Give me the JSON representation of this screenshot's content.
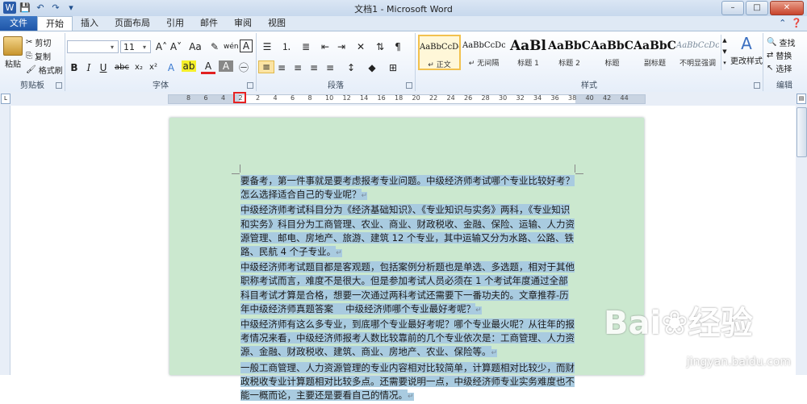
{
  "window": {
    "title": "文档1 - Microsoft Word",
    "minimize": "–",
    "maximize": "□",
    "close": "✕"
  },
  "qat": {
    "save_icon": "save-icon",
    "undo_icon": "undo-icon",
    "redo_icon": "redo-icon"
  },
  "tabs": [
    "文件",
    "开始",
    "插入",
    "页面布局",
    "引用",
    "邮件",
    "审阅",
    "视图"
  ],
  "ribbon": {
    "clipboard": {
      "label": "剪贴板",
      "paste": "粘贴",
      "cut": "剪切",
      "copy": "复制",
      "format_painter": "格式刷"
    },
    "font": {
      "label": "字体",
      "font_name": "",
      "font_size": "11",
      "bold": "B",
      "italic": "I",
      "underline": "U",
      "strike": "abc",
      "subscript": "x₂",
      "superscript": "x²",
      "grow": "A˄",
      "shrink": "A˅",
      "case": "Aa",
      "clear": "✎",
      "phonetic": "wén",
      "border_char": "A",
      "text_effect": "A",
      "highlight": "ab",
      "font_color": "A",
      "shading": "A",
      "enclose": "㊀"
    },
    "paragraph": {
      "label": "段落"
    },
    "styles": {
      "label": "样式",
      "items": [
        {
          "preview": "AaBbCcDc",
          "name": "↵ 正文"
        },
        {
          "preview": "AaBbCcDc",
          "name": "↵ 无间隔"
        },
        {
          "preview": "AaBl",
          "name": "标题 1"
        },
        {
          "preview": "AaBbC",
          "name": "标题 2"
        },
        {
          "preview": "AaBbC",
          "name": "标题"
        },
        {
          "preview": "AaBbC",
          "name": "副标题"
        },
        {
          "preview": "AaBbCcDc",
          "name": "不明显强调"
        }
      ],
      "change_styles": "更改样式"
    },
    "editing": {
      "label": "编辑",
      "find": "查找",
      "replace": "替换",
      "select": "选择"
    }
  },
  "ruler": {
    "numbers": [
      "8",
      "6",
      "4",
      "2",
      "2",
      "4",
      "6",
      "8",
      "10",
      "12",
      "14",
      "16",
      "18",
      "20",
      "22",
      "24",
      "26",
      "28",
      "30",
      "32",
      "34",
      "36",
      "38",
      "40",
      "42",
      "44"
    ]
  },
  "document": {
    "paragraphs": [
      "要备考，第一件事就是要考虑报考专业问题。中级经济师考试哪个专业比较好考？怎么选择适合自己的专业呢？",
      "中级经济师考试科目分为《经济基础知识》、《专业知识与实务》两科，《专业知识和实务》科目分为工商管理、农业、商业、财政税收、金融、保险、运输、人力资源管理、邮电、房地产、旅游、建筑 12 个专业，其中运输又分为水路、公路、铁路、民航 4 个子专业。",
      "中级经济师考试题目都是客观题，包括案例分析题也是单选、多选题，相对于其他职称考试而言，难度不是很大。但是参加考试人员必须在 1 个考试年度通过全部科目考试才算是合格，想要一次通过两科考试还需要下一番功夫的。文章推荐-历年中级经济师真题答案　 中级经济师哪个专业最好考呢？",
      "中级经济师有这么多专业，到底哪个专业最好考呢？哪个专业最火呢？从往年的报考情况来看，中级经济师报考人数比较靠前的几个专业依次是：工商管理、人力资源、金融、财政税收、建筑、商业、房地产、农业、保险等。",
      "一般工商管理、人力资源管理的专业内容相对比较简单，计算题相对比较少，而财政税收专业计算题相对比较多点。还需要说明一点，中级经济师专业实务难度也不能一概而论，主要还是要看自己的情况。"
    ],
    "para_mark": "↵"
  },
  "watermark": {
    "main": "Bai❀经验",
    "sub": "jingyan.baidu.com"
  },
  "colors": {
    "page_background": "#cbe8cf",
    "selection": "#a9cbe0",
    "accent": "#1f56a8"
  }
}
